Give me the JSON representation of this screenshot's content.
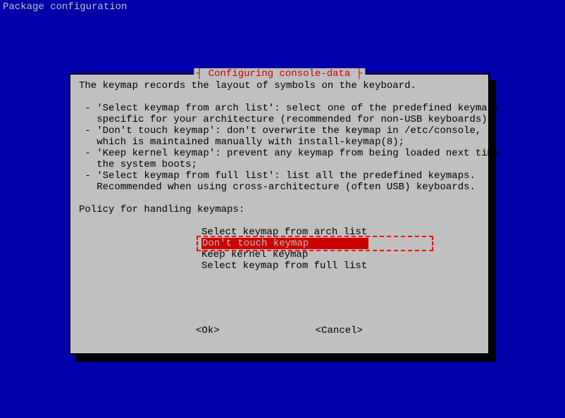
{
  "header": "Package configuration",
  "dialog": {
    "title_left": "┤",
    "title": " Configuring console-data ",
    "title_right": "├",
    "intro": "The keymap records the layout of symbols on the keyboard.",
    "bullets": [
      " - 'Select keymap from arch list': select one of the predefined keymaps",
      "   specific for your architecture (recommended for non-USB keyboards);",
      " - 'Don't touch keymap': don't overwrite the keymap in /etc/console,",
      "   which is maintained manually with install-keymap(8);",
      " - 'Keep kernel keymap': prevent any keymap from being loaded next time",
      "   the system boots;",
      " - 'Select keymap from full list': list all the predefined keymaps.",
      "   Recommended when using cross-architecture (often USB) keyboards."
    ],
    "prompt": "Policy for handling keymaps:",
    "options": [
      "Select keymap from arch list",
      "Don't touch keymap          ",
      "Keep kernel keymap",
      "Select keymap from full list"
    ],
    "selected_index": 1,
    "buttons": {
      "ok": "<Ok>",
      "cancel": "<Cancel>"
    }
  }
}
